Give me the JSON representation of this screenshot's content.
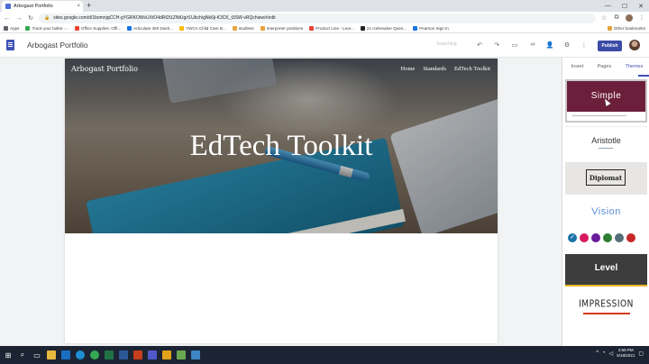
{
  "browser": {
    "tab_title": "Arbogast Portfolio",
    "tab_close": "×",
    "new_tab": "+",
    "url": "sites.google.com/d/1bomnjqCCH-gYGRKOWvUXtO4dRt2t1ZNtUg/r1Ubch/gNk6ji-K3CK_t3SW-vRQchiew/r/edit",
    "window_controls": [
      "—",
      "☐",
      "✕"
    ],
    "bookmarks": [
      {
        "label": "Apps",
        "color": "#5f6368"
      },
      {
        "label": "Track your ballot -...",
        "color": "#34a853"
      },
      {
        "label": "Office Supplies: Offi...",
        "color": "#ea4335"
      },
      {
        "label": "Articulate 360 Dash...",
        "color": "#1a73e8"
      },
      {
        "label": "YWCA Child Care B...",
        "color": "#fbbc04"
      },
      {
        "label": "studless",
        "color": "#e8a33d"
      },
      {
        "label": "Interpreter positions",
        "color": "#e8a33d"
      },
      {
        "label": "Product Line - Lear...",
        "color": "#ea4335"
      },
      {
        "label": "21 Icebreaker Ques...",
        "color": "#202124"
      },
      {
        "label": "Pearson Sign In",
        "color": "#1a73e8"
      }
    ],
    "other_bookmarks": "Other bookmarks"
  },
  "sites": {
    "title": "Arbogast Portfolio",
    "search_placeholder": "Searching",
    "publish_label": "Publish",
    "accent": "#3c4ba6"
  },
  "hero": {
    "brand": "Arbogast Portfolio",
    "nav": [
      "Home",
      "Standards",
      "EdTech Toolkit"
    ],
    "title": "EdTech Toolkit"
  },
  "panel": {
    "tabs": [
      "Insert",
      "Pages",
      "Themes"
    ],
    "active_tab": "Themes",
    "themes": [
      {
        "name": "Simple",
        "selected": true
      },
      {
        "name": "Aristotle"
      },
      {
        "name": "Diplomat"
      },
      {
        "name": "Vision"
      },
      {
        "name": "Level"
      },
      {
        "name": "IMPRESSION"
      }
    ],
    "vision_colors": [
      "#1a73a8",
      "#d81b60",
      "#6a1b9a",
      "#2e7d32",
      "#546e7a",
      "#c62828"
    ]
  },
  "taskbar": {
    "time": "2:59 PM",
    "date": "5/18/2021"
  }
}
